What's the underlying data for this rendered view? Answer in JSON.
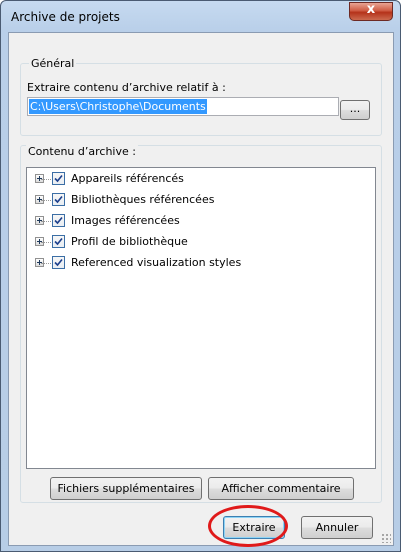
{
  "window": {
    "title": "Archive de projets",
    "close_label": "x"
  },
  "general": {
    "group_label": "Général",
    "path_label": "Extraire contenu d’archive relatif à :",
    "path_value": "C:\\Users\\Christophe\\Documents",
    "browse_label": "..."
  },
  "content": {
    "group_label": "Contenu d’archive :",
    "items": [
      {
        "label": "Appareils référencés",
        "checked": true,
        "icon": "expand-plus-icon"
      },
      {
        "label": "Bibliothèques référencées",
        "checked": true,
        "icon": "expand-plus-icon"
      },
      {
        "label": "Images référencées",
        "checked": true,
        "icon": "expand-plus-icon"
      },
      {
        "label": "Profil de bibliothèque",
        "checked": true,
        "icon": "expand-plus-icon"
      },
      {
        "label": "Referenced visualization styles",
        "checked": true,
        "icon": "expand-plus-icon"
      }
    ],
    "extra_files_label": "Fichiers supplémentaires",
    "show_comment_label": "Afficher commentaire"
  },
  "actions": {
    "extract_label": "Extraire",
    "cancel_label": "Annuler"
  },
  "colors": {
    "highlight_circle": "#e01a1a",
    "selection": "#3399ff",
    "checkmark": "#1c3f8c"
  }
}
